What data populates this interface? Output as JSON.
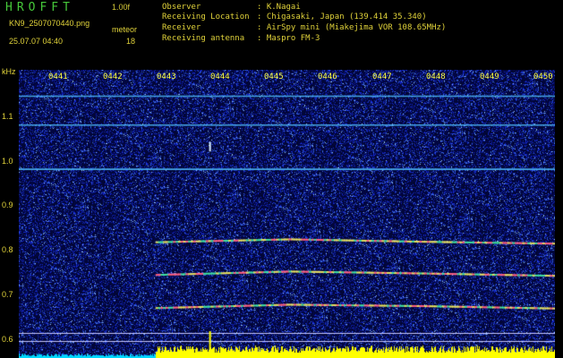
{
  "header": {
    "app_title": "HROFFT",
    "version": "1.00f",
    "filename": "KN9_2507070440.png",
    "datetime": "25.07.07 04:40",
    "mode_label": "meteor",
    "mode_value": "18"
  },
  "info": [
    {
      "label": "Observer",
      "value": ": K.Nagai"
    },
    {
      "label": "Receiving Location",
      "value": ": Chigasaki, Japan (139.414 35.340)"
    },
    {
      "label": "Receiver",
      "value": ": AirSpy mini (Miakejima VOR 108.65MHz)"
    },
    {
      "label": "Receiving antenna",
      "value": ": Maspro FM-3"
    }
  ],
  "spectrogram": {
    "y_unit": "kHz",
    "y_ticks": [
      "1.1",
      "1.0",
      "0.9",
      "0.8",
      "0.7",
      "0.6"
    ],
    "y_range": [
      0.57,
      1.17
    ],
    "x_ticks": [
      "0441",
      "0442",
      "0443",
      "0444",
      "0445",
      "0446",
      "0447",
      "0448",
      "0449",
      "0450"
    ],
    "x_range": [
      440.5,
      450.5
    ],
    "colors": {
      "background": "#000000",
      "noise_base": "#0a1a78",
      "carrier_line": "#46a8e8",
      "signal_bright": "#e8e060",
      "amplitude_trace": "#ffff00",
      "amplitude_trace_left": "#00d8ff",
      "grid_line": "#c8c8ff"
    },
    "carriers": [
      {
        "freq_khz": 1.115,
        "start_min": 440.5,
        "end_min": 450.5,
        "type": "steady"
      },
      {
        "freq_khz": 1.055,
        "start_min": 440.5,
        "end_min": 450.5,
        "type": "steady"
      },
      {
        "freq_khz": 0.963,
        "start_min": 440.5,
        "end_min": 450.5,
        "type": "steady"
      },
      {
        "freq_khz": 0.812,
        "start_min": 443.05,
        "end_min": 450.5,
        "type": "drifting",
        "drift_khz": [
          0.811,
          0.817,
          0.812,
          0.808
        ]
      },
      {
        "freq_khz": 0.745,
        "start_min": 443.05,
        "end_min": 450.5,
        "type": "drifting",
        "drift_khz": [
          0.743,
          0.75,
          0.746,
          0.741
        ]
      },
      {
        "freq_khz": 0.675,
        "start_min": 443.05,
        "end_min": 450.5,
        "type": "drifting",
        "drift_khz": [
          0.674,
          0.681,
          0.678,
          0.673
        ]
      }
    ],
    "reference_lines_khz": [
      0.622,
      0.606
    ],
    "meteor_event": {
      "time_min": 444.05,
      "freq_range_khz": [
        1.0,
        1.02
      ]
    },
    "amplitude_trace": {
      "level": 0.35,
      "switch_min": 443.05,
      "low_level": 0.12
    }
  }
}
